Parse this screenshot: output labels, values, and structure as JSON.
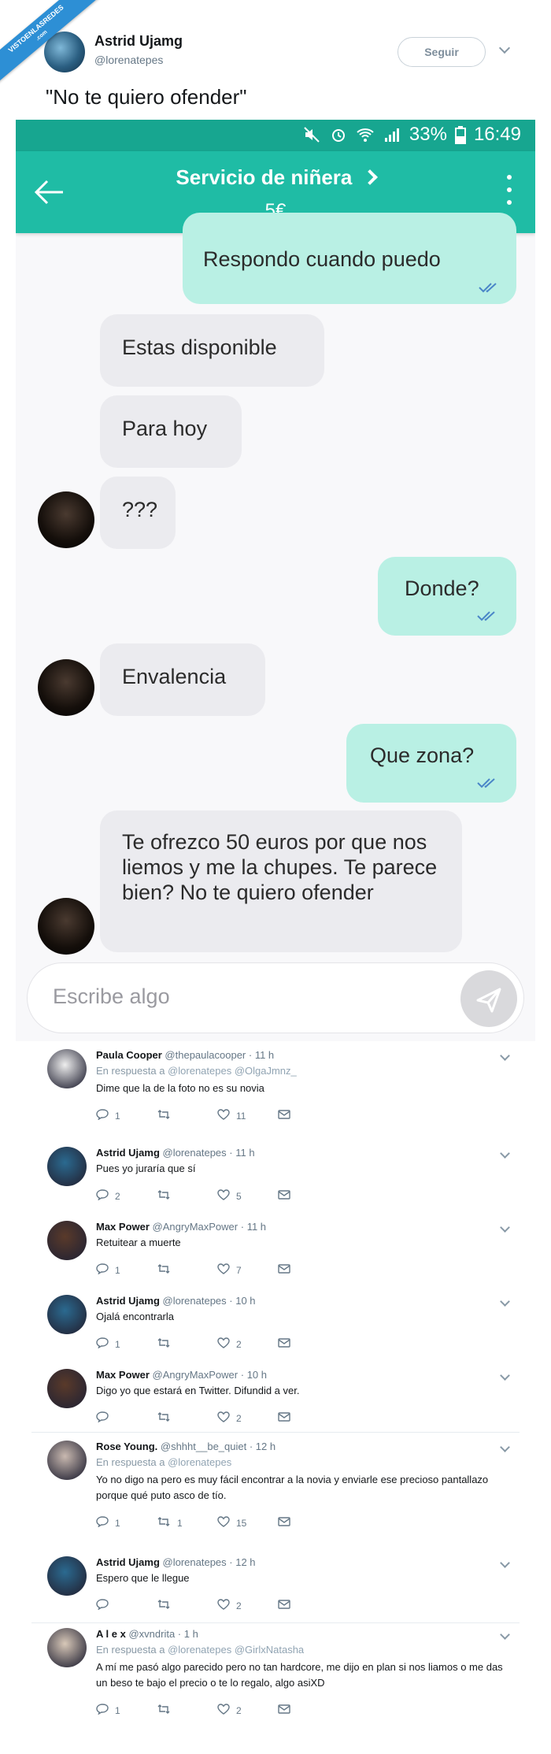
{
  "watermark": {
    "line1": "VISTOENLASREDES",
    "line2": ".com"
  },
  "tweet": {
    "name": "Astrid Ujamg",
    "handle": "@lorenatepes",
    "follow_label": "Seguir",
    "text": "\"No te quiero ofender\""
  },
  "phone": {
    "status": {
      "battery": "33%",
      "time": "16:49"
    },
    "app_title": "Servicio de niñera",
    "price": "5€",
    "messages": [
      {
        "dir": "out",
        "text": "Respondo cuando puedo"
      },
      {
        "dir": "in",
        "text": "Estas disponible"
      },
      {
        "dir": "in",
        "text": "Para hoy"
      },
      {
        "dir": "in",
        "text": "???"
      },
      {
        "dir": "out",
        "text": "Donde?"
      },
      {
        "dir": "in",
        "text": "Envalencia"
      },
      {
        "dir": "out",
        "text": "Que zona?"
      },
      {
        "dir": "in",
        "text": "Te ofrezco 50 euros por que nos liemos y me la chupes. Te parece bien? No te quiero ofender"
      }
    ],
    "composer_placeholder": "Escribe algo"
  },
  "replies": [
    {
      "name": "Paula Cooper",
      "handle": "@thepaulacooper",
      "time": "· 11 h",
      "in_reply_label": "En respuesta a",
      "in_reply_to": "@lorenatepes @OlgaJmnz_",
      "text": "Dime que la de la foto no es su novia",
      "replies": "1",
      "retweets": "",
      "likes": "11",
      "avatar_color": "#eeeeee"
    },
    {
      "name": "Astrid Ujamg",
      "handle": "@lorenatepes",
      "time": "· 11 h",
      "in_reply_label": "",
      "in_reply_to": "",
      "text": "Pues yo juraría que sí",
      "replies": "2",
      "retweets": "",
      "likes": "5",
      "avatar_color": "#2b6a90"
    },
    {
      "name": "Max Power",
      "handle": "@AngryMaxPower",
      "time": "· 11 h",
      "in_reply_label": "",
      "in_reply_to": "",
      "text": "Retuitear a muerte",
      "replies": "1",
      "retweets": "",
      "likes": "7",
      "avatar_color": "#5a3a2a"
    },
    {
      "name": "Astrid Ujamg",
      "handle": "@lorenatepes",
      "time": "· 10 h",
      "in_reply_label": "",
      "in_reply_to": "",
      "text": "Ojalá encontrarla",
      "replies": "1",
      "retweets": "",
      "likes": "2",
      "avatar_color": "#2b6a90"
    },
    {
      "name": "Max Power",
      "handle": "@AngryMaxPower",
      "time": "· 10 h",
      "in_reply_label": "",
      "in_reply_to": "",
      "text": "Digo yo que estará en Twitter. Difundid a ver.",
      "replies": "",
      "retweets": "",
      "likes": "2",
      "avatar_color": "#5a3a2a"
    },
    {
      "name": "Rose Young.",
      "handle": "@shhht__be_quiet",
      "time": "· 12 h",
      "in_reply_label": "En respuesta a",
      "in_reply_to": "@lorenatepes",
      "text": "Yo no digo na pero es muy fácil encontrar a la novia y enviarle ese precioso pantallazo porque qué puto asco de tío.",
      "replies": "1",
      "retweets": "1",
      "likes": "15",
      "avatar_color": "#c9b9b0"
    },
    {
      "name": "Astrid Ujamg",
      "handle": "@lorenatepes",
      "time": "· 12 h",
      "in_reply_label": "",
      "in_reply_to": "",
      "text": "Espero que le llegue",
      "replies": "",
      "retweets": "",
      "likes": "2",
      "avatar_color": "#2b6a90"
    },
    {
      "name": "A l e x",
      "handle": "@xvndrita",
      "time": "· 1 h",
      "in_reply_label": "En respuesta a",
      "in_reply_to": "@lorenatepes @GirlxNatasha",
      "text": "A mí me pasó algo parecido pero no tan hardcore, me dijo en plan si nos liamos o me das un beso te bajo el precio o te lo regalo, algo asiXD",
      "replies": "1",
      "retweets": "",
      "likes": "2",
      "avatar_color": "#d8c8b8"
    }
  ]
}
